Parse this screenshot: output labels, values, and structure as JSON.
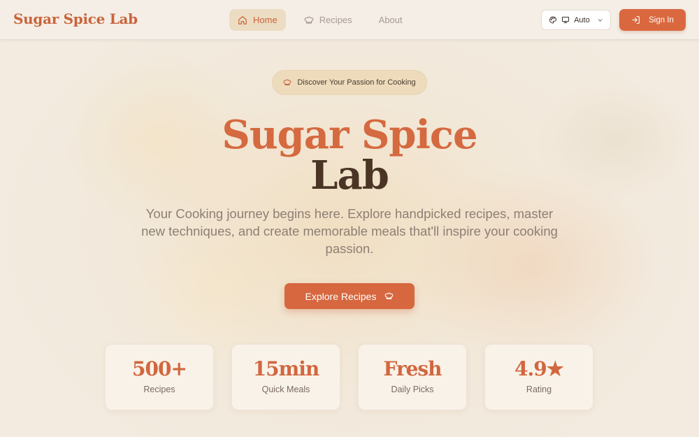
{
  "app": {
    "logo": "Sugar Spice Lab"
  },
  "nav": {
    "items": [
      {
        "label": "Home",
        "icon": "home-icon",
        "active": true
      },
      {
        "label": "Recipes",
        "icon": "chef-hat-icon",
        "active": false
      },
      {
        "label": "About",
        "icon": "",
        "active": false
      }
    ]
  },
  "theme": {
    "value": "Auto",
    "icons": [
      "palette-icon",
      "monitor-icon",
      "chevron-down-icon"
    ]
  },
  "auth": {
    "signin_label": "Sign In",
    "icon": "login-icon"
  },
  "hero": {
    "badge": "Discover Your Passion for Cooking",
    "title_line1": "Sugar Spice",
    "title_line2": "Lab",
    "subtitle": "Your Cooking journey begins here. Explore handpicked recipes, master new techniques, and create memorable meals that'll inspire your cooking passion.",
    "cta_label": "Explore Recipes"
  },
  "stats": [
    {
      "value": "500+",
      "label": "Recipes"
    },
    {
      "value": "15min",
      "label": "Quick Meals"
    },
    {
      "value": "Fresh",
      "label": "Daily Picks"
    },
    {
      "value": "4.9★",
      "label": "Rating"
    }
  ],
  "colors": {
    "accent": "#d6673f",
    "dark_text": "#4a3424",
    "background": "#efe6da"
  }
}
